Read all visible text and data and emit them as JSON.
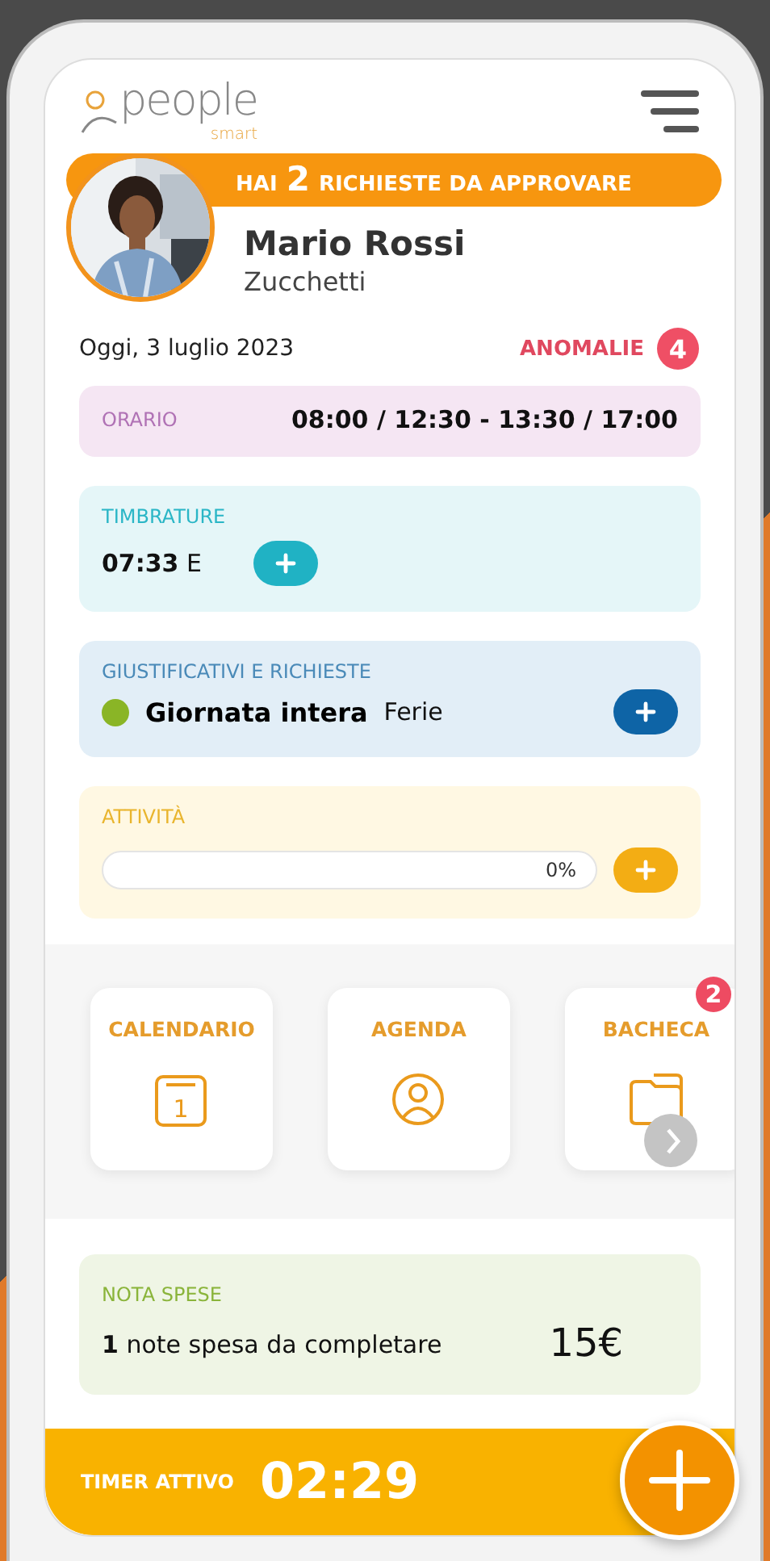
{
  "header": {
    "logo_word": "people",
    "logo_sub": "smart"
  },
  "banner": {
    "text": "HAI **2** RICHIESTE DA APPROVARE"
  },
  "user": {
    "name": "Mario Rossi",
    "company": "Zucchetti"
  },
  "day": {
    "date": "Oggi, 3 luglio 2023",
    "anomalies_label": "ANOMALIE",
    "anomalies_count": "4"
  },
  "cards": [
    {
      "kind": "schedule",
      "title": "ORARIO",
      "value": "08:00 / 12:30 - 13:30 / 17:00"
    },
    {
      "kind": "punches",
      "title": "TIMBRATURE",
      "value": "**07:33** E"
    },
    {
      "kind": "requests",
      "title": "GIUSTIFICATIVI E RICHIESTE",
      "color": "#8ab526",
      "value": "Giornata intera",
      "detail": "Ferie"
    },
    {
      "kind": "activity",
      "title": "ATTIVITÀ",
      "level": 0,
      "reading": "0%"
    }
  ],
  "shortcuts": [
    {
      "kind": "calendar",
      "label": "CALENDARIO",
      "day_number": "1"
    },
    {
      "kind": "agenda",
      "label": "AGENDA"
    },
    {
      "kind": "board",
      "label": "BACHECA",
      "badge": "2"
    }
  ],
  "expense": {
    "title": "NOTA SPESE",
    "text": "**1** note spesa da completare",
    "amount": "15€"
  },
  "timer": {
    "label": "TIMER ATTIVO",
    "time": "02:29"
  }
}
